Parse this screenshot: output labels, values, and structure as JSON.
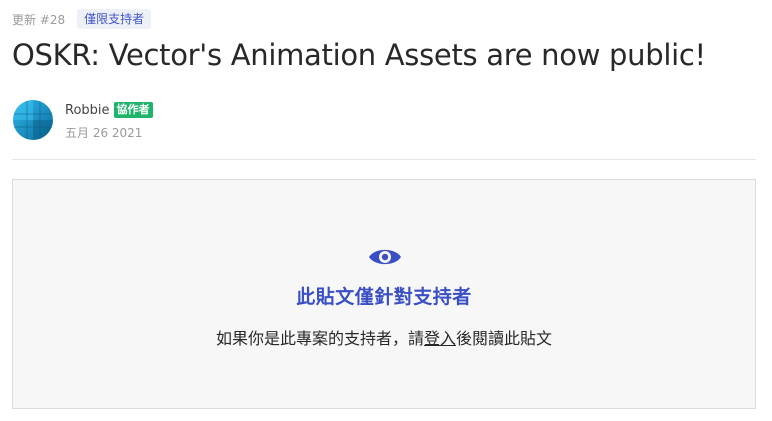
{
  "post": {
    "update_label": "更新 #28",
    "access_badge": "僅限支持者",
    "title": "OSKR: Vector's Animation Assets are now public!",
    "author": {
      "name": "Robbie",
      "role_badge": "協作者",
      "date": "五月 26 2021",
      "avatar_icon": "avatar-image"
    }
  },
  "locked": {
    "icon": "eye-icon",
    "title": "此貼文僅針對支持者",
    "message_before": "如果你是此專案的支持者，請",
    "login_link": "登入",
    "message_after": "後閱讀此貼文"
  },
  "colors": {
    "accent": "#3b4fc4",
    "role_badge": "#1fb36b",
    "panel_bg": "#f7f7f7"
  }
}
